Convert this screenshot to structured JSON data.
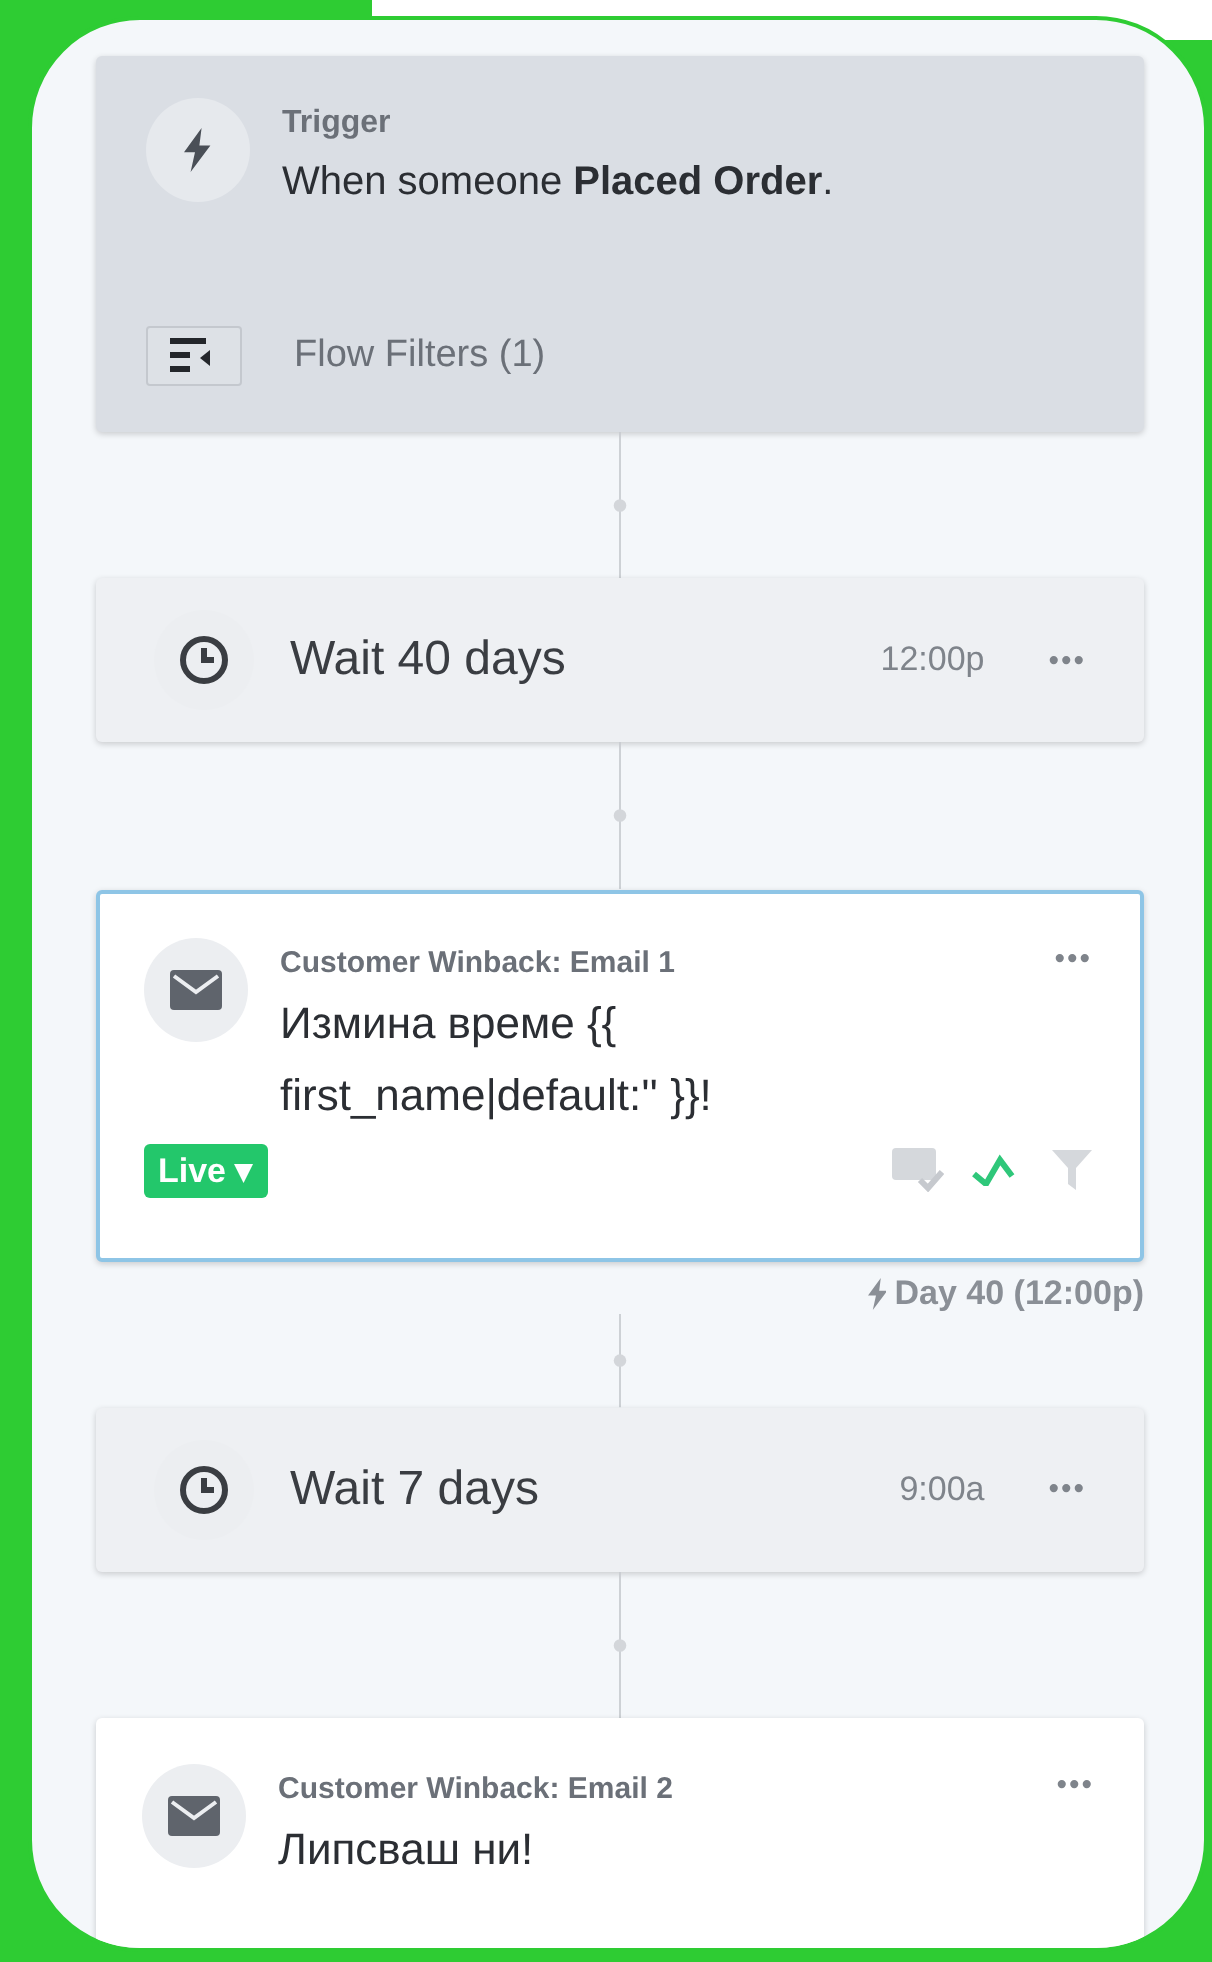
{
  "trigger": {
    "label": "Trigger",
    "text": "When someone **Placed Order**.",
    "filters": "Flow Filters (1)"
  },
  "steps": [
    {
      "kind": "wait",
      "label": "Wait 40 days",
      "time": "12:00p",
      "menu": "•••"
    },
    {
      "kind": "email",
      "title": "Customer Winback: Email 1",
      "subject": "Измина време {{ first_name|default:'' }}!",
      "menu": "•••",
      "status": "Live ▾",
      "selected": true,
      "schedule": "Day 40 (12:00p)"
    },
    {
      "kind": "wait",
      "label": "Wait 7 days",
      "time": "9:00a",
      "menu": "•••"
    },
    {
      "kind": "email",
      "title": "Customer Winback: Email 2",
      "subject": "Липсваш ни!",
      "menu": "•••",
      "selected": false
    }
  ]
}
